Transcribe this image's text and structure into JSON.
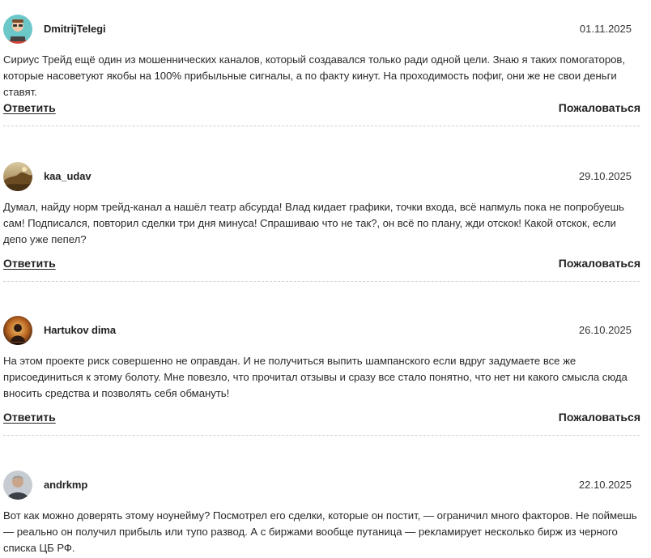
{
  "comments": [
    {
      "author": "DmitrijTelegi",
      "date": "01.11.2025",
      "text": "Сириус Трейд ещё один из мошеннических каналов, который создавался только ради одной цели. Знаю я таких помогаторов, которые насоветуют якобы на 100% прибыльные сигналы, а по факту кинут. На проходимость пофиг, они же не свои деньги ставят.",
      "reply_label": "Ответить",
      "report_label": "Пожаловаться"
    },
    {
      "author": "kaa_udav",
      "date": "29.10.2025",
      "text": "Думал, найду норм трейд-канал а нашёл театр абсурда! Влад кидает графики, точки входа, всё напмуль пока не попробуешь сам! Подписался, повторил сделки три дня минуса! Спрашиваю что не так?, он всё по плану, жди отскок! Какой отскок, если депо уже пепел?",
      "reply_label": "Ответить",
      "report_label": "Пожаловаться"
    },
    {
      "author": "Hartukov dima",
      "date": "26.10.2025",
      "text": "На этом проекте риск совершенно не оправдан. И не получиться выпить шампанского если вдруг задумаете все же присоединиться к этому болоту. Мне повезло, что прочитал отзывы и сразу все стало понятно, что нет ни какого смысла сюда вносить средства и позволять себя обмануть!",
      "reply_label": "Ответить",
      "report_label": "Пожаловаться"
    },
    {
      "author": "andrkmp",
      "date": "22.10.2025",
      "text": "Вот как можно доверять этому ноунейму? Посмотрел его сделки, которые он постит, — ограничил много факторов. Не поймешь — реально он получил прибыль или тупо развод. А с биржами вообще путаница — рекламирует несколько бирж из черного списка ЦБ РФ."
    }
  ],
  "colors": {
    "text": "#2a2a2a",
    "divider": "#cfcfcf",
    "background": "#ffffff"
  }
}
